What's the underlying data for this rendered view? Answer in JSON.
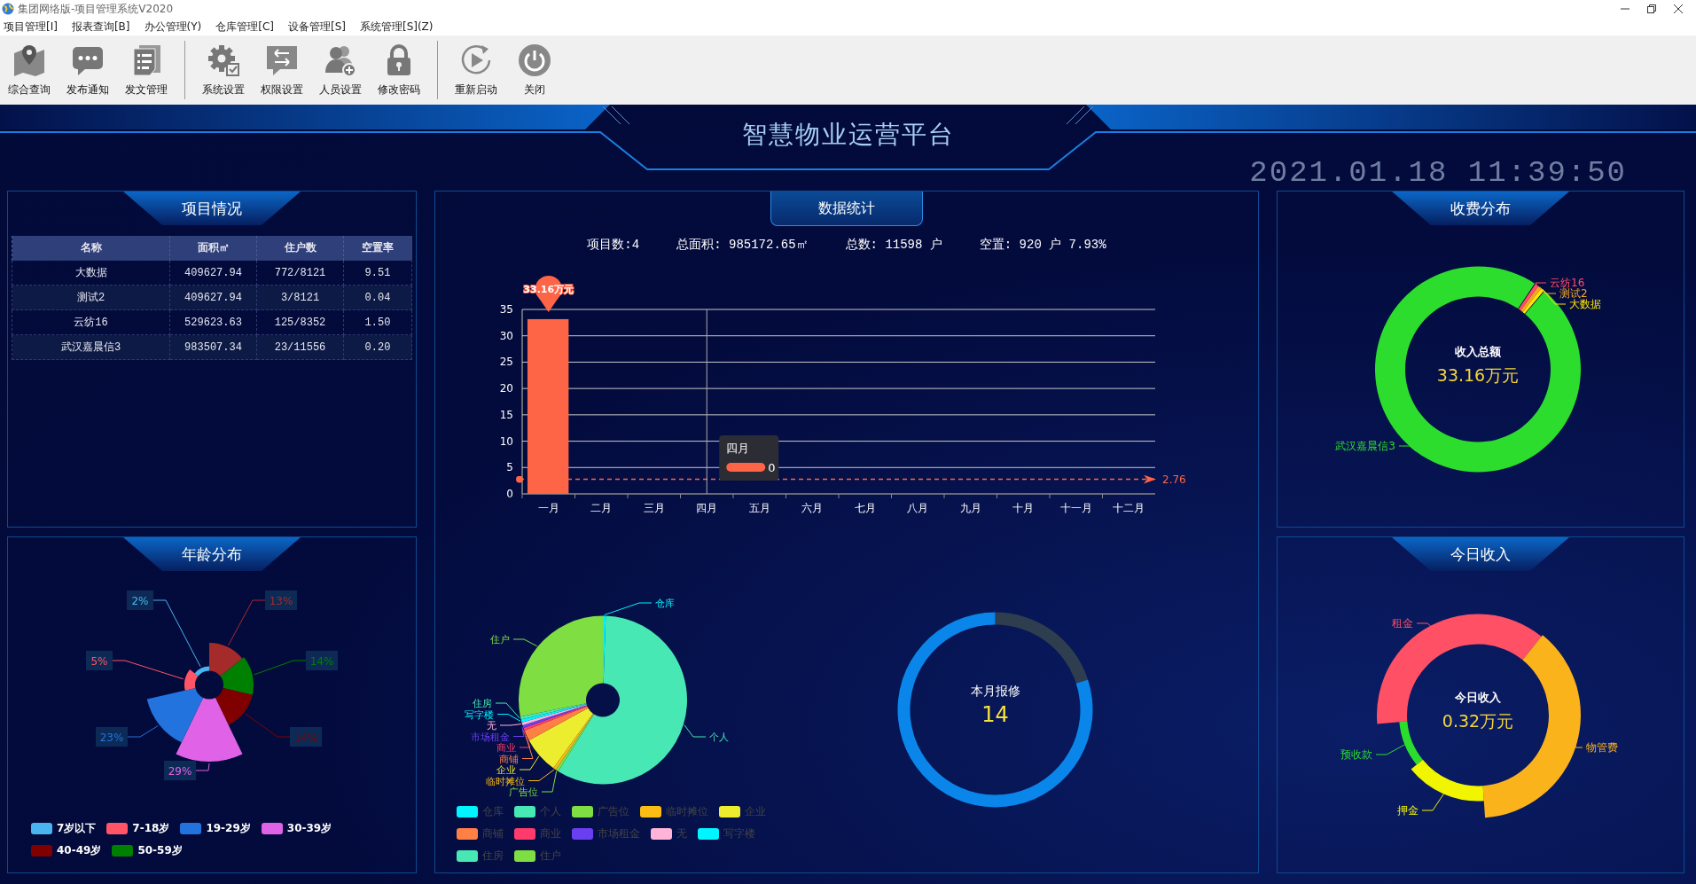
{
  "window": {
    "title": "集团网络版-项目管理系统V2020"
  },
  "menu": [
    "项目管理[I]",
    "报表查询[B]",
    "办公管理(Y)",
    "仓库管理[C]",
    "设备管理[S]",
    "系统管理[S](Z)"
  ],
  "toolbar": [
    [
      {
        "label": "综合查询",
        "kind": "map"
      },
      {
        "label": "发布通知",
        "kind": "chat"
      },
      {
        "label": "发文管理",
        "kind": "document"
      }
    ],
    [
      {
        "label": "系统设置",
        "kind": "gear"
      },
      {
        "label": "权限设置",
        "kind": "swap"
      },
      {
        "label": "人员设置",
        "kind": "users"
      },
      {
        "label": "修改密码",
        "kind": "lock"
      }
    ],
    [
      {
        "label": "重新启动",
        "kind": "replay"
      },
      {
        "label": "关闭",
        "kind": "power"
      }
    ]
  ],
  "header": {
    "title": "智慧物业运营平台",
    "clock": "2021.01.18 11:39:50"
  },
  "projects": {
    "title": "项目情况",
    "columns": [
      "名称",
      "面积㎡",
      "住户数",
      "空置率"
    ],
    "rows": [
      [
        "大数据",
        "409627.94",
        "772/8121",
        "9.51"
      ],
      [
        "测试2",
        "409627.94",
        "3/8121",
        "0.04"
      ],
      [
        "云纺16",
        "529623.63",
        "125/8352",
        "1.50"
      ],
      [
        "武汉嘉晨信3",
        "983507.34",
        "23/11556",
        "0.20"
      ]
    ]
  },
  "ages": {
    "title": "年龄分布",
    "slices": [
      {
        "label": "13%",
        "color": "#a52a2a"
      },
      {
        "label": "14%",
        "color": "#008000"
      },
      {
        "label": "14%",
        "color": "#800000"
      },
      {
        "label": "29%",
        "color": "#e062e6"
      },
      {
        "label": "23%",
        "color": "#2373de"
      },
      {
        "label": "5%",
        "color": "#ff5566"
      },
      {
        "label": "2%",
        "color": "#4ab4f0"
      }
    ],
    "legend": [
      {
        "name": "7岁以下",
        "color": "#4ab4f0"
      },
      {
        "name": "7-18岁",
        "color": "#ff5566"
      },
      {
        "name": "19-29岁",
        "color": "#2373de"
      },
      {
        "name": "30-39岁",
        "color": "#e062e6"
      },
      {
        "name": "40-49岁",
        "color": "#800000"
      },
      {
        "name": "50-59岁",
        "color": "#008000"
      }
    ]
  },
  "stats": {
    "title": "数据统计",
    "summary": [
      "项目数:4",
      "总面积: 985172.65㎡",
      "总数: 11598 户",
      "空置: 920 户 7.93%"
    ],
    "chart_data": {
      "type": "bar",
      "categories": [
        "一月",
        "二月",
        "三月",
        "四月",
        "五月",
        "六月",
        "七月",
        "八月",
        "九月",
        "十月",
        "十一月",
        "十二月"
      ],
      "values": [
        33.16,
        0,
        0,
        0,
        0,
        0,
        0,
        0,
        0,
        0,
        0,
        0
      ],
      "ylim": [
        0,
        35
      ],
      "yticks": [
        0,
        5,
        10,
        15,
        20,
        25,
        30,
        35
      ],
      "grid": true,
      "annotations": [
        {
          "text": "33.16万元",
          "y": 33.16
        }
      ],
      "ref_lines": [
        {
          "axis": "y",
          "value": 2.76,
          "label": "2.76",
          "color": "#fe6446"
        }
      ]
    },
    "tooltip": {
      "title": "四月",
      "value": "0"
    },
    "pie": {
      "labels": [
        "仓库",
        "住户",
        "住房",
        "写字楼",
        "无",
        "市场租金",
        "商业",
        "商铺",
        "企业",
        "临时摊位",
        "广告位",
        "个人"
      ],
      "legend": [
        {
          "name": "仓库",
          "color": "#00f5ff"
        },
        {
          "name": "个人",
          "color": "#48e8b4"
        },
        {
          "name": "广告位",
          "color": "#7ede42"
        },
        {
          "name": "临时摊位",
          "color": "#fbbd14"
        },
        {
          "name": "企业",
          "color": "#eded2f"
        },
        {
          "name": "商铺",
          "color": "#ff7f45"
        },
        {
          "name": "商业",
          "color": "#ff3b6b"
        },
        {
          "name": "市场租金",
          "color": "#6a3ff0"
        },
        {
          "name": "无",
          "color": "#ffb3d9"
        },
        {
          "name": "写字楼",
          "color": "#00f5ff"
        },
        {
          "name": "住房",
          "color": "#48e8b4"
        },
        {
          "name": "住户",
          "color": "#7ede42"
        }
      ]
    },
    "repair": {
      "label": "本月报修",
      "value": "14"
    }
  },
  "fees": {
    "title": "收费分布",
    "center_label": "收入总额",
    "center_value": "33.16万元",
    "labels": [
      {
        "text": "云纺16",
        "color": "#ff4d6a"
      },
      {
        "text": "测试2",
        "color": "#f5a623"
      },
      {
        "text": "大数据",
        "color": "#ffe600"
      },
      {
        "text": "武汉嘉晨信3",
        "color": "#2ddd2d"
      }
    ]
  },
  "income": {
    "title": "今日收入",
    "center_label": "今日收入",
    "center_value": "0.32万元",
    "labels": [
      {
        "text": "租金",
        "color": "#ff5065"
      },
      {
        "text": "物管费",
        "color": "#fbb31c"
      },
      {
        "text": "押金",
        "color": "#f2f500"
      },
      {
        "text": "预收款",
        "color": "#2ddd2d"
      }
    ]
  }
}
